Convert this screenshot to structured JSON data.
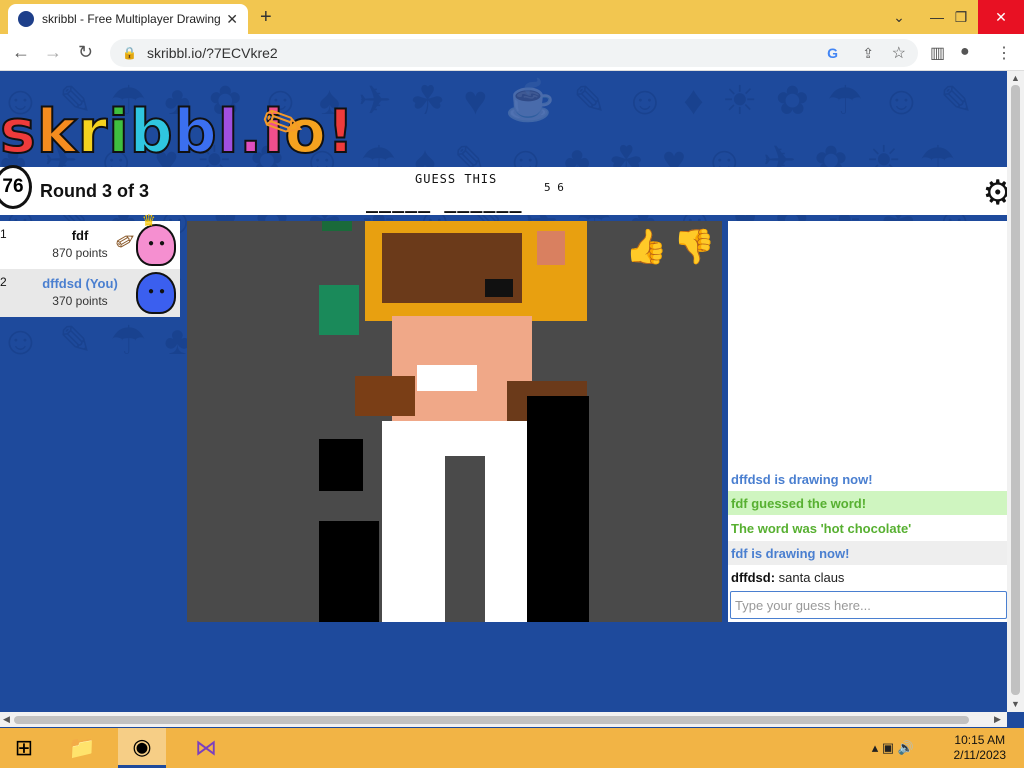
{
  "browser": {
    "tab_title": "skribbl - Free Multiplayer Drawing",
    "url": "skribbl.io/?7ECVkre2",
    "new_tab_glyph": "+",
    "tab_close_glyph": "✕"
  },
  "page": {
    "logo_text": "skribbl.io",
    "timer": "76",
    "round_text": "Round 3 of 3",
    "guess_title": "GUESS THIS",
    "word_hint": "_____ ______",
    "word_lengths": "5 6"
  },
  "players": [
    {
      "rank": "1",
      "name": "fdf",
      "points": "870 points"
    },
    {
      "rank": "2",
      "name": "dffdsd (You)",
      "points": "370 points"
    }
  ],
  "chat": {
    "messages": [
      {
        "text": "dffdsd is drawing now!"
      },
      {
        "text": "fdf guessed the word!"
      },
      {
        "text": "The word was 'hot chocolate'"
      },
      {
        "text": "fdf is drawing now!"
      },
      {
        "author": "dffdsd:",
        "body": "santa claus"
      }
    ],
    "placeholder": "Type your guess here..."
  },
  "taskbar": {
    "time": "10:15 AM",
    "date": "2/11/2023"
  },
  "colors": {
    "page_bg": "#1e4a9c",
    "system_msg": "#4a7fd0",
    "correct_msg": "#57b031",
    "correct_bg": "#cff5c0"
  }
}
